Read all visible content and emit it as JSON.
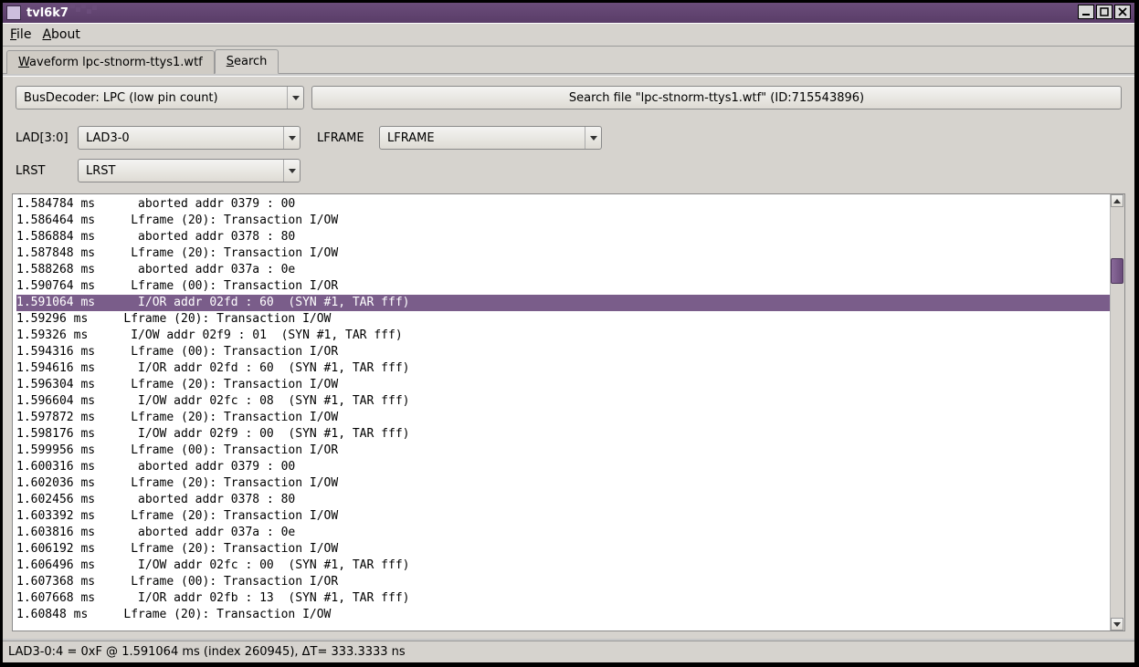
{
  "window": {
    "title": "tvl6k7"
  },
  "menubar": {
    "file": "File",
    "about": "About"
  },
  "tabs": {
    "waveform": "Waveform lpc-stnorm-ttys1.wtf",
    "search": "Search"
  },
  "controls": {
    "decoder": "BusDecoder: LPC (low pin count)",
    "search_button": "Search file \"lpc-stnorm-ttys1.wtf\" (ID:715543896)",
    "lad_label": "LAD[3:0]",
    "lad_value": "LAD3-0",
    "lframe_label": "LFRAME",
    "lframe_value": "LFRAME",
    "lrst_label": "LRST",
    "lrst_value": "LRST"
  },
  "results": [
    {
      "t": "1.584784 ms      aborted addr 0379 : 00",
      "sel": false
    },
    {
      "t": "1.586464 ms     Lframe (20): Transaction I/OW",
      "sel": false
    },
    {
      "t": "1.586884 ms      aborted addr 0378 : 80",
      "sel": false
    },
    {
      "t": "1.587848 ms     Lframe (20): Transaction I/OW",
      "sel": false
    },
    {
      "t": "1.588268 ms      aborted addr 037a : 0e",
      "sel": false
    },
    {
      "t": "1.590764 ms     Lframe (00): Transaction I/OR",
      "sel": false
    },
    {
      "t": "1.591064 ms      I/OR addr 02fd : 60  (SYN #1, TAR fff)",
      "sel": true
    },
    {
      "t": "1.59296 ms     Lframe (20): Transaction I/OW",
      "sel": false
    },
    {
      "t": "1.59326 ms      I/OW addr 02f9 : 01  (SYN #1, TAR fff)",
      "sel": false
    },
    {
      "t": "1.594316 ms     Lframe (00): Transaction I/OR",
      "sel": false
    },
    {
      "t": "1.594616 ms      I/OR addr 02fd : 60  (SYN #1, TAR fff)",
      "sel": false
    },
    {
      "t": "1.596304 ms     Lframe (20): Transaction I/OW",
      "sel": false
    },
    {
      "t": "1.596604 ms      I/OW addr 02fc : 08  (SYN #1, TAR fff)",
      "sel": false
    },
    {
      "t": "1.597872 ms     Lframe (20): Transaction I/OW",
      "sel": false
    },
    {
      "t": "1.598176 ms      I/OW addr 02f9 : 00  (SYN #1, TAR fff)",
      "sel": false
    },
    {
      "t": "1.599956 ms     Lframe (00): Transaction I/OR",
      "sel": false
    },
    {
      "t": "1.600316 ms      aborted addr 0379 : 00",
      "sel": false
    },
    {
      "t": "1.602036 ms     Lframe (20): Transaction I/OW",
      "sel": false
    },
    {
      "t": "1.602456 ms      aborted addr 0378 : 80",
      "sel": false
    },
    {
      "t": "1.603392 ms     Lframe (20): Transaction I/OW",
      "sel": false
    },
    {
      "t": "1.603816 ms      aborted addr 037a : 0e",
      "sel": false
    },
    {
      "t": "1.606192 ms     Lframe (20): Transaction I/OW",
      "sel": false
    },
    {
      "t": "1.606496 ms      I/OW addr 02fc : 00  (SYN #1, TAR fff)",
      "sel": false
    },
    {
      "t": "1.607368 ms     Lframe (00): Transaction I/OR",
      "sel": false
    },
    {
      "t": "1.607668 ms      I/OR addr 02fb : 13  (SYN #1, TAR fff)",
      "sel": false
    },
    {
      "t": "1.60848 ms     Lframe (20): Transaction I/OW",
      "sel": false
    }
  ],
  "statusbar": {
    "text": "LAD3-0:4 = 0xF @ 1.591064 ms  (index 260945), ΔT= 333.3333 ns"
  }
}
